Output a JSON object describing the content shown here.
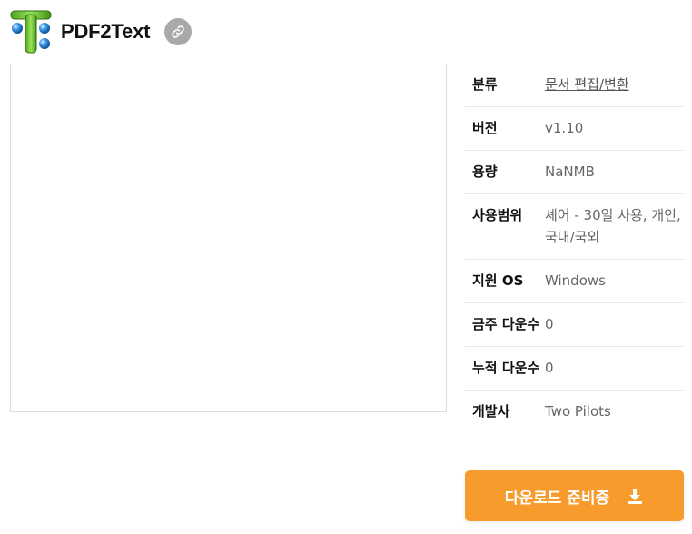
{
  "app": {
    "title": "PDF2Text"
  },
  "info": {
    "rows": [
      {
        "label": "분류",
        "value": "문서 편집/변환"
      },
      {
        "label": "버전",
        "value": "v1.10"
      },
      {
        "label": "용량",
        "value": "NaNMB"
      },
      {
        "label": "사용범위",
        "value": "셰어 - 30일 사용, 개인, 국내/국외"
      },
      {
        "label": "지원 OS",
        "value": "Windows"
      },
      {
        "label": "금주 다운수",
        "value": "0"
      },
      {
        "label": "누적 다운수",
        "value": "0"
      },
      {
        "label": "개발사",
        "value": "Two Pilots"
      }
    ]
  },
  "download": {
    "label": "다운로드 준비중"
  },
  "colors": {
    "accent": "#f89b2d",
    "link_button": "#a9a9a9",
    "logo_green": "#7ccf3a",
    "logo_blue": "#2f8fe0"
  },
  "icons": {
    "logo": "pdf2text-logo-icon",
    "link": "link-icon",
    "download": "download-icon"
  }
}
